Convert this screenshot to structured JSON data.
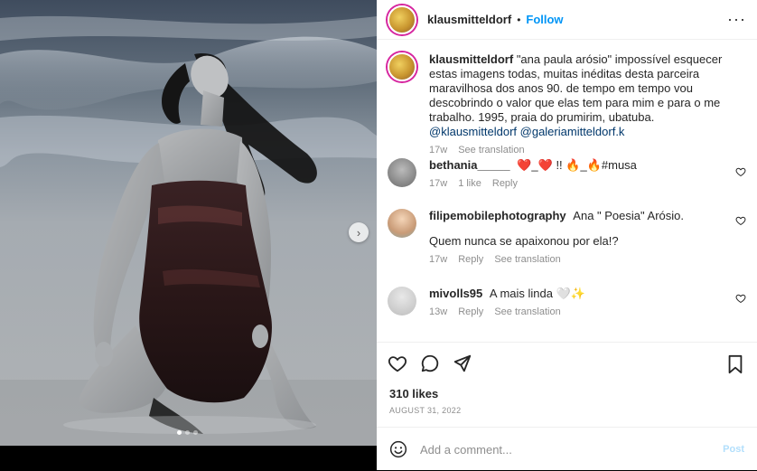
{
  "header": {
    "username": "klausmitteldorf",
    "separator": "•",
    "follow_label": "Follow",
    "more_label": "···"
  },
  "caption": {
    "username": "klausmitteldorf",
    "text": "\"ana paula arósio\" impossível esquecer estas imagens todas, muitas inéditas desta parceira maravilhosa dos anos 90. de tempo em tempo vou descobrindo o valor que elas tem para mim e para o me trabalho. 1995, praia do prumirim, ubatuba.",
    "mentions": [
      "@klausmitteldorf",
      "@galeriamitteldorf.k"
    ],
    "time": "17w",
    "see_translation": "See translation"
  },
  "comments": [
    {
      "username": "bethania_____",
      "text": "❤️_❤️ !! 🔥_🔥#musa",
      "time": "17w",
      "likes": "1 like",
      "reply": "Reply"
    },
    {
      "username": "filipemobilephotography",
      "text": "Ana \" Poesia\" Arósio.",
      "text2": "Quem nunca se apaixonou por ela!?",
      "time": "17w",
      "reply": "Reply",
      "see_translation": "See translation"
    },
    {
      "username": "mivolls95",
      "text": "A mais linda 🤍✨",
      "time": "13w",
      "reply": "Reply",
      "see_translation": "See translation"
    }
  ],
  "post": {
    "likes": "310 likes",
    "date": "AUGUST 31, 2022"
  },
  "composer": {
    "placeholder": "Add a comment...",
    "post_label": "Post"
  },
  "carousel": {
    "next_icon": "chevron-right-icon",
    "dots": 3,
    "active_dot": 1
  },
  "colors": {
    "link": "#0095f6",
    "mention": "#00376b",
    "muted": "#8e8e8e"
  }
}
